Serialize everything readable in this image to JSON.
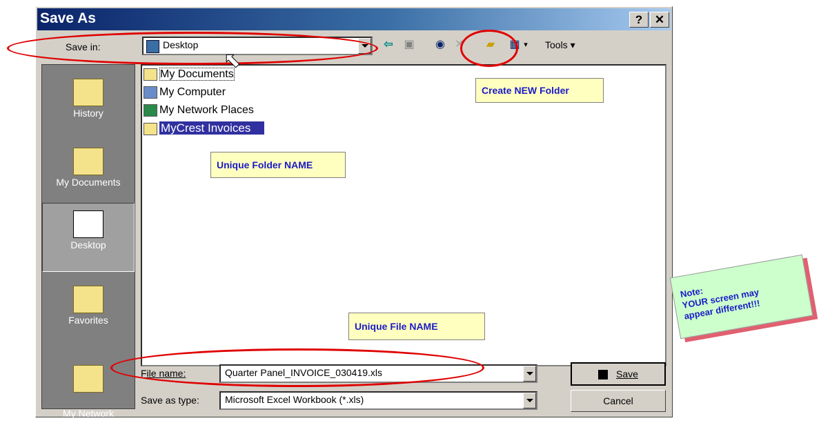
{
  "dialog": {
    "title": "Save As",
    "help_label": "?",
    "close_label": "✕"
  },
  "save_in": {
    "label": "Save in:",
    "value": "Desktop"
  },
  "toolbar": {
    "tools_label": "Tools",
    "tools_arrow": "▾"
  },
  "places": [
    {
      "label": "History"
    },
    {
      "label": "My Documents"
    },
    {
      "label": "Desktop"
    },
    {
      "label": "Favorites"
    },
    {
      "label": "My Network\nPlaces"
    }
  ],
  "files": [
    {
      "name": "My Documents",
      "icon": "documents-folder-icon"
    },
    {
      "name": "My Computer",
      "icon": "computer-icon"
    },
    {
      "name": "My Network Places",
      "icon": "network-icon"
    },
    {
      "name": "MyCrest Invoices",
      "icon": "folder-icon"
    }
  ],
  "file_name": {
    "label": "File name:",
    "value": "Quarter Panel_INVOICE_030419.xls"
  },
  "save_type": {
    "label": "Save as type:",
    "value": "Microsoft Excel Workbook (*.xls)"
  },
  "buttons": {
    "save": "Save",
    "cancel": "Cancel"
  },
  "annotations": {
    "create_folder": "Create NEW Folder",
    "unique_folder": "Unique Folder NAME",
    "unique_file": "Unique File NAME",
    "note_line1": "Note:",
    "note_line2": "YOUR screen may",
    "note_line3": "appear different!!!"
  },
  "colors": {
    "accent_red": "#e00000",
    "callout_text": "#1a1ac8",
    "selection": "#0a246a"
  }
}
